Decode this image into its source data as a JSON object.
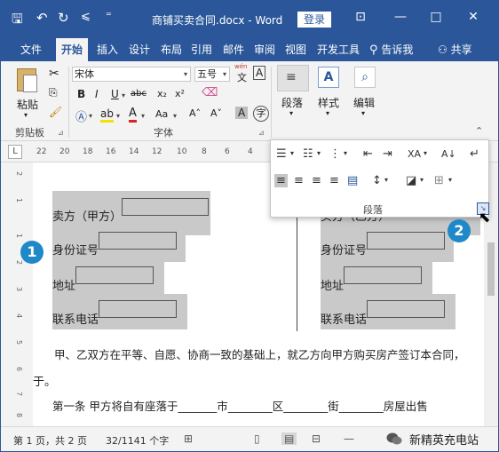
{
  "titlebar": {
    "title": "商铺买卖合同.docx  -  Word",
    "login": "登录",
    "save_icon": "save-icon",
    "undo_icon": "undo-icon",
    "redo_icon": "redo-icon",
    "touch_icon": "touch-mode-icon",
    "customize_icon": "customize-icon",
    "ribbon_display_icon": "ribbon-display-icon",
    "min_icon": "minimize-icon",
    "max_icon": "maximize-icon",
    "close_icon": "close-icon",
    "glyphs": {
      "save": "🖫",
      "undo": "↶",
      "redo": "↻",
      "touch": "⩽",
      "customize": "⁼",
      "ribbon": "⊡",
      "min": "—",
      "max": "□",
      "close": "✕"
    }
  },
  "tabs": [
    {
      "label": "文件"
    },
    {
      "label": "开始"
    },
    {
      "label": "插入"
    },
    {
      "label": "设计"
    },
    {
      "label": "布局"
    },
    {
      "label": "引用"
    },
    {
      "label": "邮件"
    },
    {
      "label": "审阅"
    },
    {
      "label": "视图"
    },
    {
      "label": "开发工具"
    },
    {
      "label": "告诉我"
    },
    {
      "label": "共享"
    }
  ],
  "ribbon": {
    "clipboard": {
      "paste": "粘贴",
      "group": "剪贴板"
    },
    "font": {
      "font_name": "宋体",
      "font_size": "五号",
      "wen": "wén",
      "wen_char": "文",
      "a_box": "A",
      "bold": "B",
      "italic": "I",
      "underline": "U",
      "strike": "abc",
      "sub": "x₂",
      "sup": "x²",
      "font_color": "A",
      "change_case": "Aa",
      "grow": "A˄",
      "shrink": "A˅",
      "char_shade": "A",
      "enclose": "字",
      "group": "字体"
    },
    "paragraph": {
      "label": "段落"
    },
    "styles": {
      "label": "样式",
      "glyph": "A"
    },
    "editing": {
      "label": "编辑",
      "glyph": "⌕"
    }
  },
  "ruler": {
    "corner": "L",
    "ticks": [
      "22",
      "20",
      "18",
      "16",
      "14",
      "12",
      "10",
      "8",
      "6",
      "4"
    ]
  },
  "vruler": [
    "2",
    "1",
    "1",
    "2",
    "3",
    "4",
    "5",
    "6",
    "7",
    "8"
  ],
  "document": {
    "left_rows": [
      "卖方（甲方）",
      "身份证号",
      "地址",
      "联系电话"
    ],
    "right_rows": [
      "买方（乙方）",
      "身份证号",
      "地址",
      "联系电话"
    ],
    "para1_line1": "甲、乙双方在平等、自愿、协商一致的基础上，就乙方向甲方购买房产签订本合同，",
    "para1_line2": "于。",
    "para2": "第一条  甲方将自有座落于_______市________区________街________房屋出售"
  },
  "paragraph_panel": {
    "label": "段落",
    "glyphs": {
      "bullets": "☰",
      "numbering": "☷",
      "multilevel": "⋮",
      "dec_indent": "⇤",
      "inc_indent": "⇥",
      "asian_layout": "ⅩA",
      "sort": "A↓",
      "show_marks": "↵",
      "align_left": "≡",
      "align_center": "≡",
      "align_right": "≡",
      "justify": "≡",
      "distribute": "▤",
      "line_spacing": "↕",
      "shading": "◪",
      "borders": "⊞",
      "launcher": "↘"
    }
  },
  "callouts": {
    "one": "1",
    "two": "2"
  },
  "statusbar": {
    "page": "第 1 页，共 2 页",
    "words": "32/1141 个字",
    "proof_icon": "proofing-icon",
    "watermark": "新精英充电站"
  }
}
